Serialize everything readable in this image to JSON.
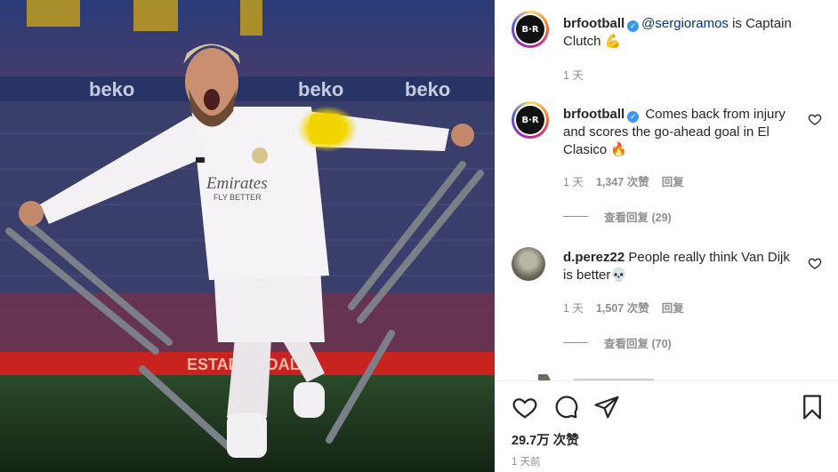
{
  "post_image": {
    "jersey_sponsor": "Emirates",
    "jersey_sponsor_sub": "FLY BETTER",
    "stadium_ad": "beko",
    "banner_text": "ESTADI ... DALM"
  },
  "caption": {
    "username": "brfootball",
    "avatar_text": "B·R",
    "mention": "@sergioramos",
    "text": " is Captain Clutch 💪",
    "time": "1 天"
  },
  "comments": [
    {
      "username": "brfootball",
      "avatar_text": "B·R",
      "text": "Comes back from injury and scores the go-ahead goal in El Clasico 🔥",
      "time": "1 天",
      "likes": "1,347 次赞",
      "reply": "回复",
      "view_replies": "查看回复 (29)"
    },
    {
      "username": "d.perez22",
      "text": "People really think Van Dijk is better💀",
      "time": "1 天",
      "likes": "1,507 次赞",
      "reply": "回复",
      "view_replies": "查看回复 (70)"
    }
  ],
  "footer": {
    "likes": "29.7万 次赞",
    "ago": "1 天前"
  },
  "icons": {
    "like": "heart-icon",
    "comment": "comment-icon",
    "share": "paper-plane-icon",
    "save": "bookmark-icon"
  },
  "colors": {
    "verified": "#3897f0",
    "mention": "#00376b",
    "muted": "#8e8e8e"
  }
}
